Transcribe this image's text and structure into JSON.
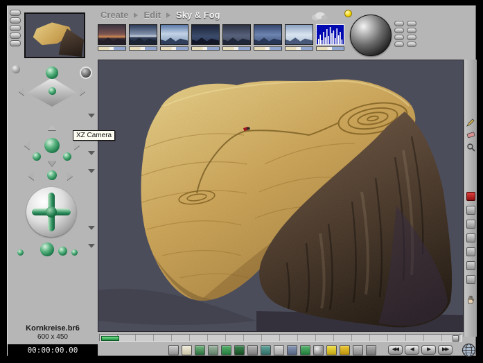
{
  "colors": {
    "frame_gray": "#b6b6b6",
    "viewport_background": "#4c4d5b",
    "sand": "#cda353",
    "cliff": "#4a3a2f",
    "widget_green": "#2e8f5f",
    "histogram_blue": "#0008b0",
    "sun_yellow": "#f2d400",
    "timeline_green": "#1f8f3f",
    "render_red": "#b01515"
  },
  "menu": {
    "items": [
      {
        "label": "Create",
        "active": false
      },
      {
        "label": "Edit",
        "active": false
      },
      {
        "label": "Sky & Fog",
        "active": true
      }
    ]
  },
  "sky_presets": {
    "count": 8,
    "note": "seven sky preset thumbnails plus one histogram thumbnail"
  },
  "tooltip": {
    "text": "XZ Camera"
  },
  "status": {
    "filename": "Kornkreise.br6",
    "resolution": "600 x 450",
    "timecode": "00:00:00.00"
  },
  "playback": {
    "buttons": [
      {
        "name": "jump-start-button",
        "glyph": "◀◀"
      },
      {
        "name": "step-back-button",
        "glyph": "◀"
      },
      {
        "name": "play-button",
        "glyph": "▶"
      },
      {
        "name": "jump-end-button",
        "glyph": "▶▶"
      }
    ]
  }
}
